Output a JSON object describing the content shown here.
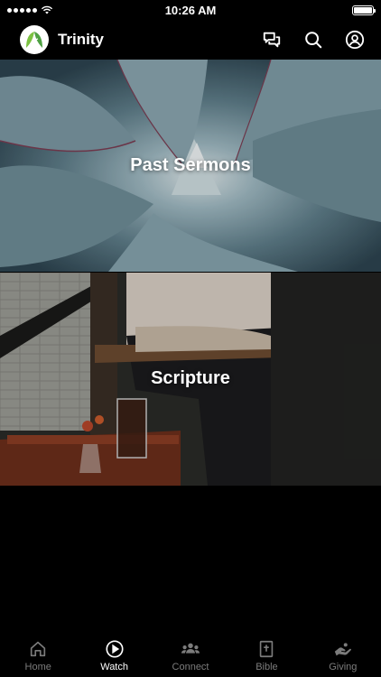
{
  "status": {
    "time": "10:26 AM"
  },
  "header": {
    "title": "Trinity"
  },
  "cards": [
    {
      "label": "Past Sermons"
    },
    {
      "label": "Scripture"
    }
  ],
  "tabs": [
    {
      "label": "Home",
      "icon": "home-icon",
      "active": false
    },
    {
      "label": "Watch",
      "icon": "play-icon",
      "active": true
    },
    {
      "label": "Connect",
      "icon": "people-icon",
      "active": false
    },
    {
      "label": "Bible",
      "icon": "bible-icon",
      "active": false
    },
    {
      "label": "Giving",
      "icon": "giving-hand-icon",
      "active": false
    }
  ],
  "colors": {
    "active_tab": "#ffffff",
    "inactive_tab": "#7c7c7c",
    "background": "#000000",
    "logo_green": "#7cc242"
  }
}
